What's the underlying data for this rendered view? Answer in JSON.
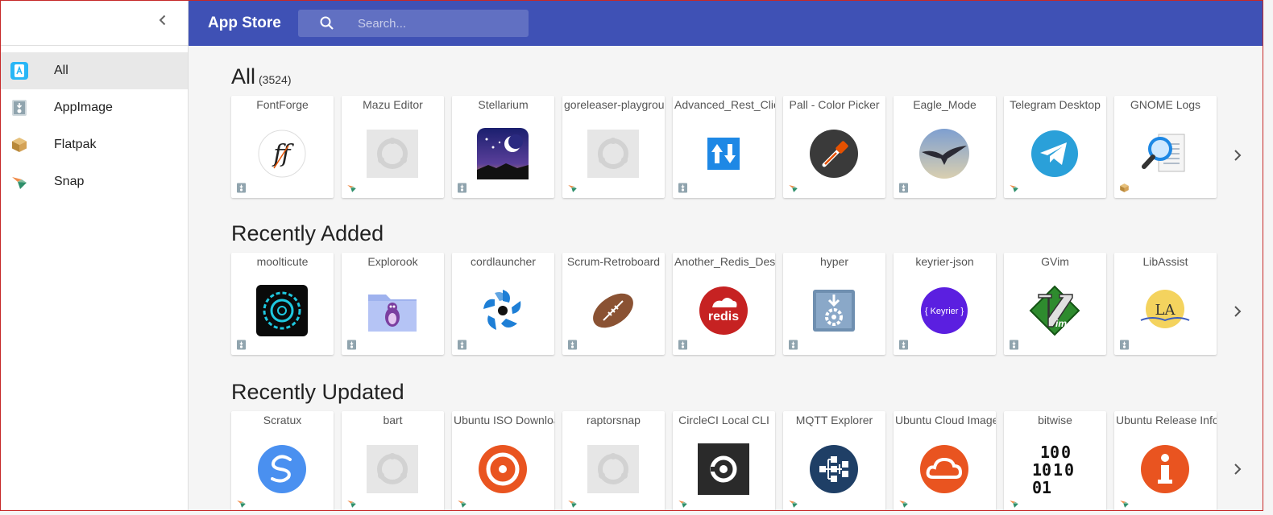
{
  "app": {
    "title": "App Store"
  },
  "search": {
    "placeholder": "Search..."
  },
  "sidebar": {
    "items": [
      {
        "label": "All",
        "icon": "app-store-icon",
        "active": true
      },
      {
        "label": "AppImage",
        "icon": "appimage-icon"
      },
      {
        "label": "Flatpak",
        "icon": "flatpak-icon"
      },
      {
        "label": "Snap",
        "icon": "snap-icon"
      }
    ]
  },
  "sections": [
    {
      "title": "All",
      "count": "(3524)",
      "apps": [
        {
          "name": "FontForge",
          "icon": "fontforge-icon",
          "badge": "appimage"
        },
        {
          "name": "Mazu Editor",
          "icon": "placeholder-app-icon",
          "badge": "snap"
        },
        {
          "name": "Stellarium",
          "icon": "stellarium-icon",
          "badge": "appimage"
        },
        {
          "name": "goreleaser-playground",
          "icon": "placeholder-app-icon",
          "badge": "snap"
        },
        {
          "name": "Advanced_Rest_Client",
          "icon": "arrows-updown-icon",
          "badge": "appimage"
        },
        {
          "name": "Pall - Color Picker",
          "icon": "eyedropper-icon",
          "badge": "snap"
        },
        {
          "name": "Eagle_Mode",
          "icon": "eagle-icon",
          "badge": "appimage"
        },
        {
          "name": "Telegram Desktop",
          "icon": "telegram-icon",
          "badge": "snap"
        },
        {
          "name": "GNOME Logs",
          "icon": "magnifier-logs-icon",
          "badge": "flatpak"
        }
      ]
    },
    {
      "title": "Recently Added",
      "apps": [
        {
          "name": "moolticute",
          "icon": "moolticute-icon",
          "badge": "appimage"
        },
        {
          "name": "Explorook",
          "icon": "folder-bird-icon",
          "badge": "appimage"
        },
        {
          "name": "cordlauncher",
          "icon": "cordlauncher-icon",
          "badge": "appimage"
        },
        {
          "name": "Scrum-Retroboard",
          "icon": "football-icon",
          "badge": "appimage"
        },
        {
          "name": "Another_Redis_Desktop",
          "icon": "redis-icon",
          "badge": "appimage"
        },
        {
          "name": "hyper",
          "icon": "installer-gear-icon",
          "badge": "appimage"
        },
        {
          "name": "keyrier-json",
          "icon": "keyrier-icon",
          "badge": "appimage"
        },
        {
          "name": "GVim",
          "icon": "vim-icon",
          "badge": "appimage"
        },
        {
          "name": "LibAssist",
          "icon": "libassist-icon",
          "badge": "appimage"
        }
      ]
    },
    {
      "title": "Recently Updated",
      "apps": [
        {
          "name": "Scratux",
          "icon": "scratux-icon",
          "badge": "snap"
        },
        {
          "name": "bart",
          "icon": "placeholder-app-icon",
          "badge": "snap"
        },
        {
          "name": "Ubuntu ISO Downloader",
          "icon": "disc-icon",
          "badge": "snap"
        },
        {
          "name": "raptorsnap",
          "icon": "placeholder-app-icon",
          "badge": "snap"
        },
        {
          "name": "CircleCI Local CLI",
          "icon": "circleci-icon",
          "badge": "snap"
        },
        {
          "name": "MQTT Explorer",
          "icon": "mqtt-icon",
          "badge": "snap"
        },
        {
          "name": "Ubuntu Cloud Image",
          "icon": "cloud-icon",
          "badge": "snap"
        },
        {
          "name": "bitwise",
          "icon": "binary-icon",
          "badge": "snap"
        },
        {
          "name": "Ubuntu Release Info",
          "icon": "info-icon",
          "badge": "snap"
        }
      ]
    }
  ],
  "colors": {
    "topbar": "#3f51b5",
    "sidebar_active": "#e8e8e8",
    "frame_border": "#c62828"
  },
  "icons": {
    "collapse": "chevron-left-icon",
    "next": "chevron-right-icon",
    "search": "search-icon"
  }
}
